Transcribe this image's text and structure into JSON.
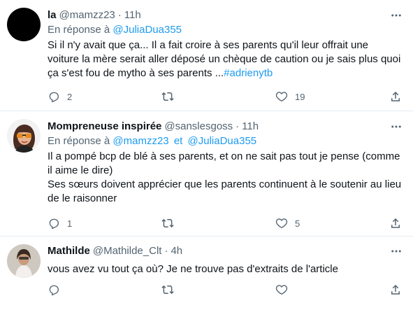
{
  "tweets": [
    {
      "name": "la",
      "handle": "@mamzz23",
      "time": "11h",
      "reply_prefix": "En réponse à",
      "reply_to": [
        "@JuliaDua355"
      ],
      "reply_joiner": "",
      "body_lines": [
        "Si il n'y avait que ça... Il a fait croire à ses parents qu'il leur offrait une",
        "voiture la mère serait aller déposé un chèque de caution ou je sais plus quoi",
        "ça s'est fou de mytho à ses parents ..."
      ],
      "hashtag": "#adrienytb",
      "replies": "2",
      "retweets": "",
      "likes": "19",
      "avatar": "black-circle-avatar"
    },
    {
      "name": "Mompreneuse inspirée",
      "handle": "@sanslesgoss",
      "time": "11h",
      "reply_prefix": "En réponse à",
      "reply_to": [
        "@mamzz23",
        "@JuliaDua355"
      ],
      "reply_joiner": "et",
      "body_lines": [
        "Il a pompé bcp de blé à ses parents, et on ne sait pas tout je pense (comme",
        "il aime le dire)",
        "Ses sœurs doivent apprécier que les parents continuent à le soutenir au lieu",
        "de le raisonner"
      ],
      "replies": "1",
      "retweets": "",
      "likes": "5",
      "avatar": "cartoon-woman-sunglasses-avatar"
    },
    {
      "name": "Mathilde",
      "handle": "@Mathilde_Clt",
      "time": "4h",
      "body_lines": [
        "vous avez vu tout ça où? Je ne trouve pas d'extraits de l'article"
      ],
      "replies": "",
      "retweets": "",
      "likes": "",
      "avatar": "photo-avatar"
    }
  ],
  "colors": {
    "text": "#0f1419",
    "muted": "#536471",
    "link": "#1d9bf0",
    "divider": "#e6ecf0"
  },
  "icons": [
    "more-icon",
    "reply-icon",
    "retweet-icon",
    "like-icon",
    "share-icon"
  ]
}
